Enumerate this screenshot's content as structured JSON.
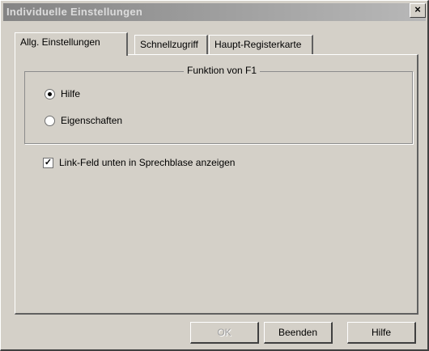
{
  "window": {
    "title": "Individuelle Einstellungen",
    "close_label": "×"
  },
  "tabs": [
    {
      "label": "Allg. Einstellungen"
    },
    {
      "label": "Schnellzugriff"
    },
    {
      "label": "Haupt-Registerkarte"
    }
  ],
  "group": {
    "legend": "Funktion von F1",
    "options": [
      {
        "label": "Hilfe",
        "selected": true
      },
      {
        "label": "Eigenschaften",
        "selected": false
      }
    ]
  },
  "checkbox": {
    "label": "Link-Feld unten in Sprechblase anzeigen",
    "checked": true,
    "mark": "✓"
  },
  "buttons": {
    "ok": "OK",
    "close": "Beenden",
    "help": "Hilfe"
  }
}
